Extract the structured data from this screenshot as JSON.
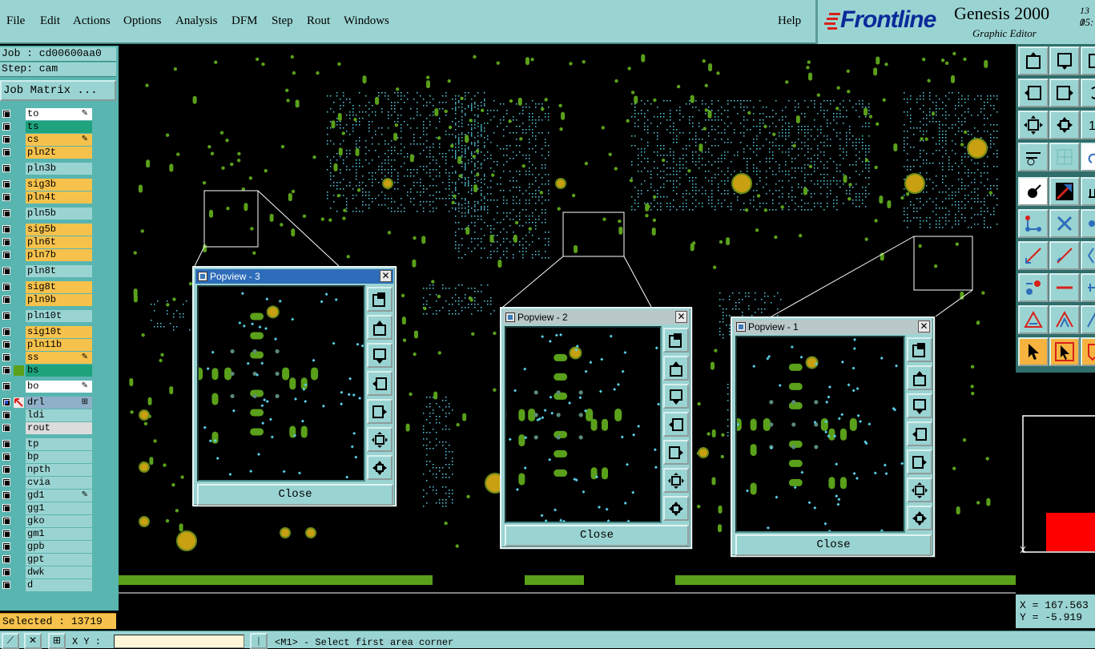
{
  "menu": [
    "File",
    "Edit",
    "Actions",
    "Options",
    "Analysis",
    "DFM",
    "Step",
    "Rout",
    "Windows"
  ],
  "help": "Help",
  "brand": {
    "logo": "Frontline",
    "product": "Genesis 2000",
    "subtitle": "Graphic Editor",
    "date_partial": "13 J",
    "time_partial": "05:"
  },
  "job": {
    "job_label": "Job : cd00600aa0",
    "step_label": "Step: cam",
    "matrix_button": "Job Matrix ..."
  },
  "layers": [
    {
      "name": "to",
      "color": "#ffffff",
      "flag": "pen"
    },
    {
      "name": "ts",
      "color": "#1ea37d",
      "flag": ""
    },
    {
      "name": "cs",
      "color": "#f6c24c",
      "flag": "pen"
    },
    {
      "name": "pln2t",
      "color": "#f6c24c",
      "flag": ""
    },
    {
      "name": "pln3b",
      "color": "#9ad4d2",
      "flag": ""
    },
    {
      "name": "sig3b",
      "color": "#f6c24c",
      "flag": ""
    },
    {
      "name": "pln4t",
      "color": "#f6c24c",
      "flag": ""
    },
    {
      "name": "pln5b",
      "color": "#9ad4d2",
      "flag": ""
    },
    {
      "name": "sig5b",
      "color": "#f6c24c",
      "flag": ""
    },
    {
      "name": "pln6t",
      "color": "#f6c24c",
      "flag": ""
    },
    {
      "name": "pln7b",
      "color": "#f6c24c",
      "flag": ""
    },
    {
      "name": "pln8t",
      "color": "#9ad4d2",
      "flag": ""
    },
    {
      "name": "sig8t",
      "color": "#f6c24c",
      "flag": ""
    },
    {
      "name": "pln9b",
      "color": "#f6c24c",
      "flag": ""
    },
    {
      "name": "pln10t",
      "color": "#9ad4d2",
      "flag": ""
    },
    {
      "name": "sig10t",
      "color": "#f6c24c",
      "flag": ""
    },
    {
      "name": "pln11b",
      "color": "#f6c24c",
      "flag": ""
    },
    {
      "name": "ss",
      "color": "#f6c24c",
      "flag": "pen"
    },
    {
      "name": "bs",
      "color": "#1ea37d",
      "flag": ""
    },
    {
      "name": "bo",
      "color": "#ffffff",
      "flag": "pen"
    },
    {
      "name": "drl",
      "color": "#8fb0c8",
      "flag": "grid"
    },
    {
      "name": "ldi",
      "color": "#9ad4d2",
      "flag": ""
    },
    {
      "name": "rout",
      "color": "#dcdcdc",
      "flag": ""
    },
    {
      "name": "tp",
      "color": "#9ad4d2",
      "flag": ""
    },
    {
      "name": "bp",
      "color": "#9ad4d2",
      "flag": ""
    },
    {
      "name": "npth",
      "color": "#9ad4d2",
      "flag": ""
    },
    {
      "name": "cvia",
      "color": "#9ad4d2",
      "flag": ""
    },
    {
      "name": "gd1",
      "color": "#9ad4d2",
      "flag": "pen"
    },
    {
      "name": "gg1",
      "color": "#9ad4d2",
      "flag": ""
    },
    {
      "name": "gko",
      "color": "#9ad4d2",
      "flag": ""
    },
    {
      "name": "gm1",
      "color": "#9ad4d2",
      "flag": ""
    },
    {
      "name": "gpb",
      "color": "#9ad4d2",
      "flag": ""
    },
    {
      "name": "gpt",
      "color": "#9ad4d2",
      "flag": ""
    },
    {
      "name": "dwk",
      "color": "#9ad4d2",
      "flag": ""
    },
    {
      "name": "d",
      "color": "#9ad4d2",
      "flag": ""
    }
  ],
  "selected": "Selected : 13719",
  "popviews": [
    {
      "title": "Popview - 3",
      "close": "Close",
      "state": "active"
    },
    {
      "title": "Popview - 2",
      "close": "Close",
      "state": "inactive"
    },
    {
      "title": "Popview - 1",
      "close": "Close",
      "state": "inactive"
    }
  ],
  "coords": {
    "x": "X = 167.563",
    "y": "Y = -5.919"
  },
  "bottom": {
    "xy_label": "X Y :",
    "xy_value": "",
    "status": "<M1> - Select first area corner"
  },
  "colors": {
    "panel": "#9ad4d2",
    "pad_green": "#5aa01a",
    "pad_gold": "#c8a012",
    "via_cyan": "#5ad0e8",
    "highlight": "#f6c24c"
  }
}
